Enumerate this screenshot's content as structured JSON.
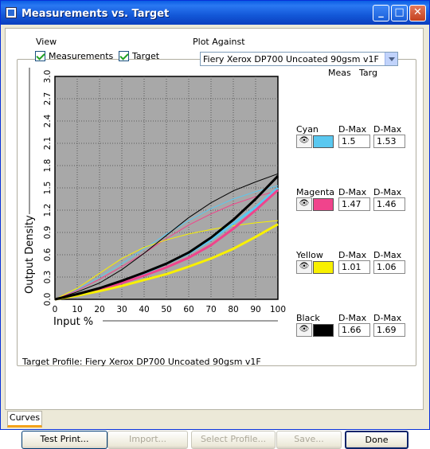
{
  "window": {
    "title": "Measurements vs. Target",
    "icon": "app-icon"
  },
  "title_buttons": {
    "minimize": "_",
    "maximize": "□",
    "close": "✕"
  },
  "view": {
    "label": "View",
    "measurements_label": "Measurements",
    "measurements_checked": true,
    "target_label": "Target",
    "target_checked": true
  },
  "plot_against": {
    "label": "Plot Against",
    "selected": "Fiery Xerox DP700 Uncoated 90gsm v1F"
  },
  "columns": {
    "meas": "Meas",
    "targ": "Targ"
  },
  "channels": [
    {
      "name": "Cyan",
      "meas_label": "D-Max",
      "targ_label": "D-Max",
      "meas": "1.5",
      "targ": "1.53",
      "color": "#5ac8f0"
    },
    {
      "name": "Magenta",
      "meas_label": "D-Max",
      "targ_label": "D-Max",
      "meas": "1.47",
      "targ": "1.46",
      "color": "#f0448c"
    },
    {
      "name": "Yellow",
      "meas_label": "D-Max",
      "targ_label": "D-Max",
      "meas": "1.01",
      "targ": "1.06",
      "color": "#f8f000"
    },
    {
      "name": "Black",
      "meas_label": "D-Max",
      "targ_label": "D-Max",
      "meas": "1.66",
      "targ": "1.69",
      "color": "#000000"
    }
  ],
  "chart_data": {
    "type": "line",
    "xlabel": "Input %",
    "ylabel": "Output Density",
    "xlim": [
      0,
      100
    ],
    "ylim": [
      0,
      3.0
    ],
    "grid": true,
    "x_ticks": [
      "0",
      "10",
      "20",
      "30",
      "40",
      "50",
      "60",
      "70",
      "80",
      "90",
      "100"
    ],
    "y_ticks": [
      "0.0",
      "0.3",
      "0.6",
      "0.9",
      "1.2",
      "1.5",
      "1.8",
      "2.1",
      "2.4",
      "2.7",
      "3.0"
    ],
    "x": [
      0,
      10,
      20,
      30,
      40,
      50,
      60,
      70,
      80,
      90,
      100
    ],
    "series": [
      {
        "kind": "measurement",
        "color": "#5ac8f0",
        "values": [
          0,
          0.06,
          0.14,
          0.24,
          0.35,
          0.48,
          0.62,
          0.8,
          1.02,
          1.24,
          1.5
        ]
      },
      {
        "kind": "measurement",
        "color": "#f0448c",
        "values": [
          0,
          0.06,
          0.13,
          0.22,
          0.32,
          0.43,
          0.56,
          0.73,
          0.95,
          1.2,
          1.47
        ]
      },
      {
        "kind": "measurement",
        "color": "#f8f000",
        "values": [
          0,
          0.05,
          0.11,
          0.18,
          0.26,
          0.34,
          0.44,
          0.55,
          0.68,
          0.84,
          1.01
        ]
      },
      {
        "kind": "measurement",
        "color": "#000000",
        "values": [
          0,
          0.07,
          0.15,
          0.25,
          0.36,
          0.48,
          0.63,
          0.83,
          1.07,
          1.35,
          1.66
        ]
      },
      {
        "kind": "target",
        "color": "#5ac8f0",
        "values": [
          0,
          0.13,
          0.3,
          0.48,
          0.68,
          0.88,
          1.06,
          1.22,
          1.35,
          1.45,
          1.53
        ]
      },
      {
        "kind": "target",
        "color": "#f0448c",
        "values": [
          0,
          0.12,
          0.27,
          0.44,
          0.62,
          0.82,
          1.0,
          1.15,
          1.28,
          1.38,
          1.46
        ]
      },
      {
        "kind": "target",
        "color": "#f8f000",
        "values": [
          0,
          0.15,
          0.35,
          0.55,
          0.7,
          0.8,
          0.88,
          0.94,
          0.99,
          1.03,
          1.06
        ]
      },
      {
        "kind": "target",
        "color": "#000000",
        "values": [
          0,
          0.1,
          0.22,
          0.4,
          0.62,
          0.86,
          1.1,
          1.3,
          1.46,
          1.58,
          1.69
        ]
      }
    ]
  },
  "target_profile": "Target Profile: Fiery Xerox DP700 Uncoated 90gsm v1F",
  "tab": "Curves",
  "buttons": {
    "test_print": "Test Print...",
    "import": "Import...",
    "select_profile": "Select Profile...",
    "save": "Save...",
    "done": "Done"
  }
}
